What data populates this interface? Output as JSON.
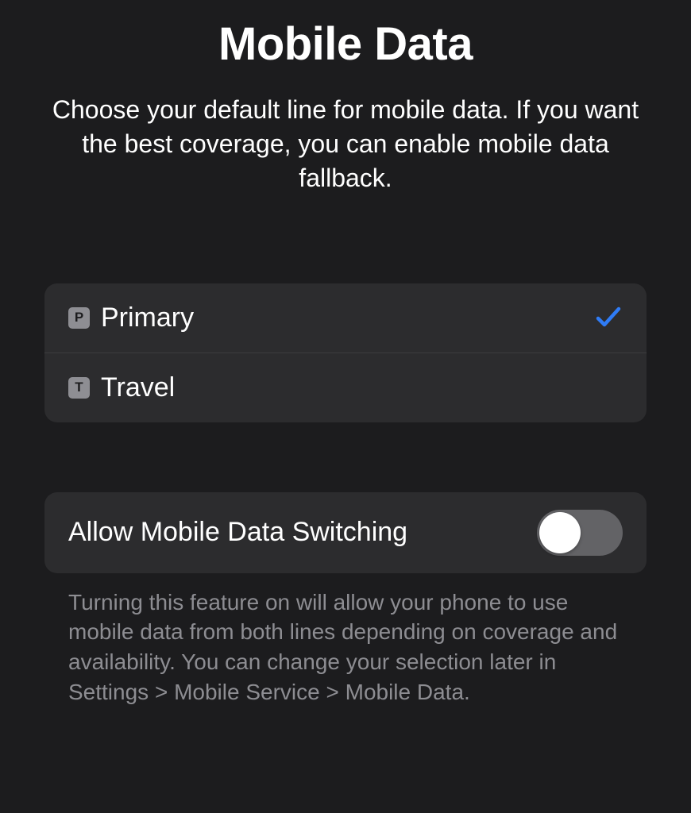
{
  "header": {
    "title": "Mobile Data",
    "subtitle": "Choose your default line for mobile data. If you want the best coverage, you can enable mobile data fallback."
  },
  "lines": [
    {
      "badge": "P",
      "label": "Primary",
      "selected": true
    },
    {
      "badge": "T",
      "label": "Travel",
      "selected": false
    }
  ],
  "toggle": {
    "label": "Allow Mobile Data Switching",
    "enabled": false
  },
  "footer": {
    "text": "Turning this feature on will allow your phone to use mobile data from both lines depending on coverage and availability. You can change your selection later in Settings > Mobile Service > Mobile Data."
  },
  "colors": {
    "accent": "#2f7cf6"
  }
}
